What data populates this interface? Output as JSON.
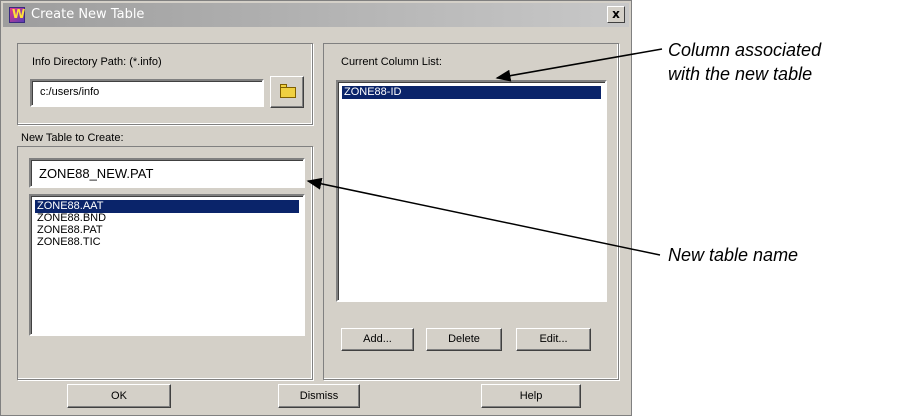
{
  "window": {
    "title": "Create New Table",
    "close_label": "x"
  },
  "info_dir": {
    "label": "Info Directory Path: (*.info)",
    "value": "c:/users/info"
  },
  "new_table": {
    "label": "New Table to Create:",
    "value": "ZONE88_NEW.PAT",
    "items": [
      "ZONE88.AAT",
      "ZONE88.BND",
      "ZONE88.PAT",
      "ZONE88.TIC"
    ],
    "selected_index": 0
  },
  "columns": {
    "label": "Current Column List:",
    "items": [
      "ZONE88-ID"
    ],
    "selected_index": 0
  },
  "buttons": {
    "add": "Add...",
    "delete": "Delete",
    "edit": "Edit...",
    "ok": "OK",
    "dismiss": "Dismiss",
    "help": "Help"
  },
  "annotations": {
    "column_line1": "Column associated",
    "column_line2": "with the new table",
    "table_name": "New table name"
  },
  "icons": {
    "app": "app-icon",
    "folder": "folder-icon"
  }
}
